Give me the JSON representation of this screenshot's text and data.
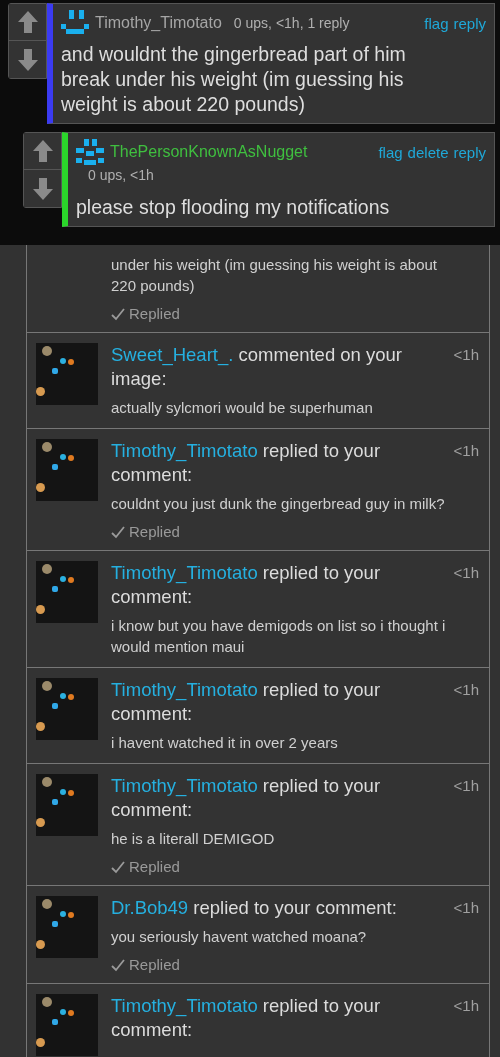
{
  "comments": [
    {
      "kind": "other",
      "color": "#3b3bf2",
      "user": "Timothy_Timotato",
      "meta": "0 ups, <1h, 1 reply",
      "actions": [
        "flag",
        "reply"
      ],
      "text": "and wouldnt the gingerbread part of him break under his weight (im guessing his weight is about 220 pounds)"
    },
    {
      "kind": "own",
      "color": "#2bd62b",
      "user": "ThePersonKnownAsNugget",
      "meta": "0 ups, <1h",
      "actions": [
        "flag",
        "delete",
        "reply"
      ],
      "text": "please stop flooding my notifications"
    }
  ],
  "notifications": [
    {
      "message": "under his weight (im guessing his weight is about 220 pounds)",
      "replied": true,
      "reply_label": "Replied"
    },
    {
      "user": "Sweet_Heart_.",
      "action": "commented on your image:",
      "time": "<1h",
      "message": "actually sylcmori would be superhuman",
      "replied": false
    },
    {
      "user": "Timothy_Timotato",
      "action": "replied to your comment:",
      "time": "<1h",
      "message": "couldnt you just dunk the gingerbread guy in milk?",
      "replied": true,
      "reply_label": "Replied"
    },
    {
      "user": "Timothy_Timotato",
      "action": "replied to your comment:",
      "time": "<1h",
      "message": "i know but you have demigods on list so i thought i would mention maui",
      "replied": false
    },
    {
      "user": "Timothy_Timotato",
      "action": "replied to your comment:",
      "time": "<1h",
      "message": "i havent watched it in over 2 years",
      "replied": false
    },
    {
      "user": "Timothy_Timotato",
      "action": "replied to your comment:",
      "time": "<1h",
      "message": "he is a literall DEMIGOD",
      "replied": true,
      "reply_label": "Replied"
    },
    {
      "user": "Dr.Bob49",
      "action": "replied to your comment:",
      "time": "<1h",
      "message": "you seriously havent watched moana?",
      "replied": true,
      "reply_label": "Replied"
    },
    {
      "user": "Timothy_Timotato",
      "action": "replied to your comment:",
      "time": "<1h",
      "replied": false
    }
  ]
}
